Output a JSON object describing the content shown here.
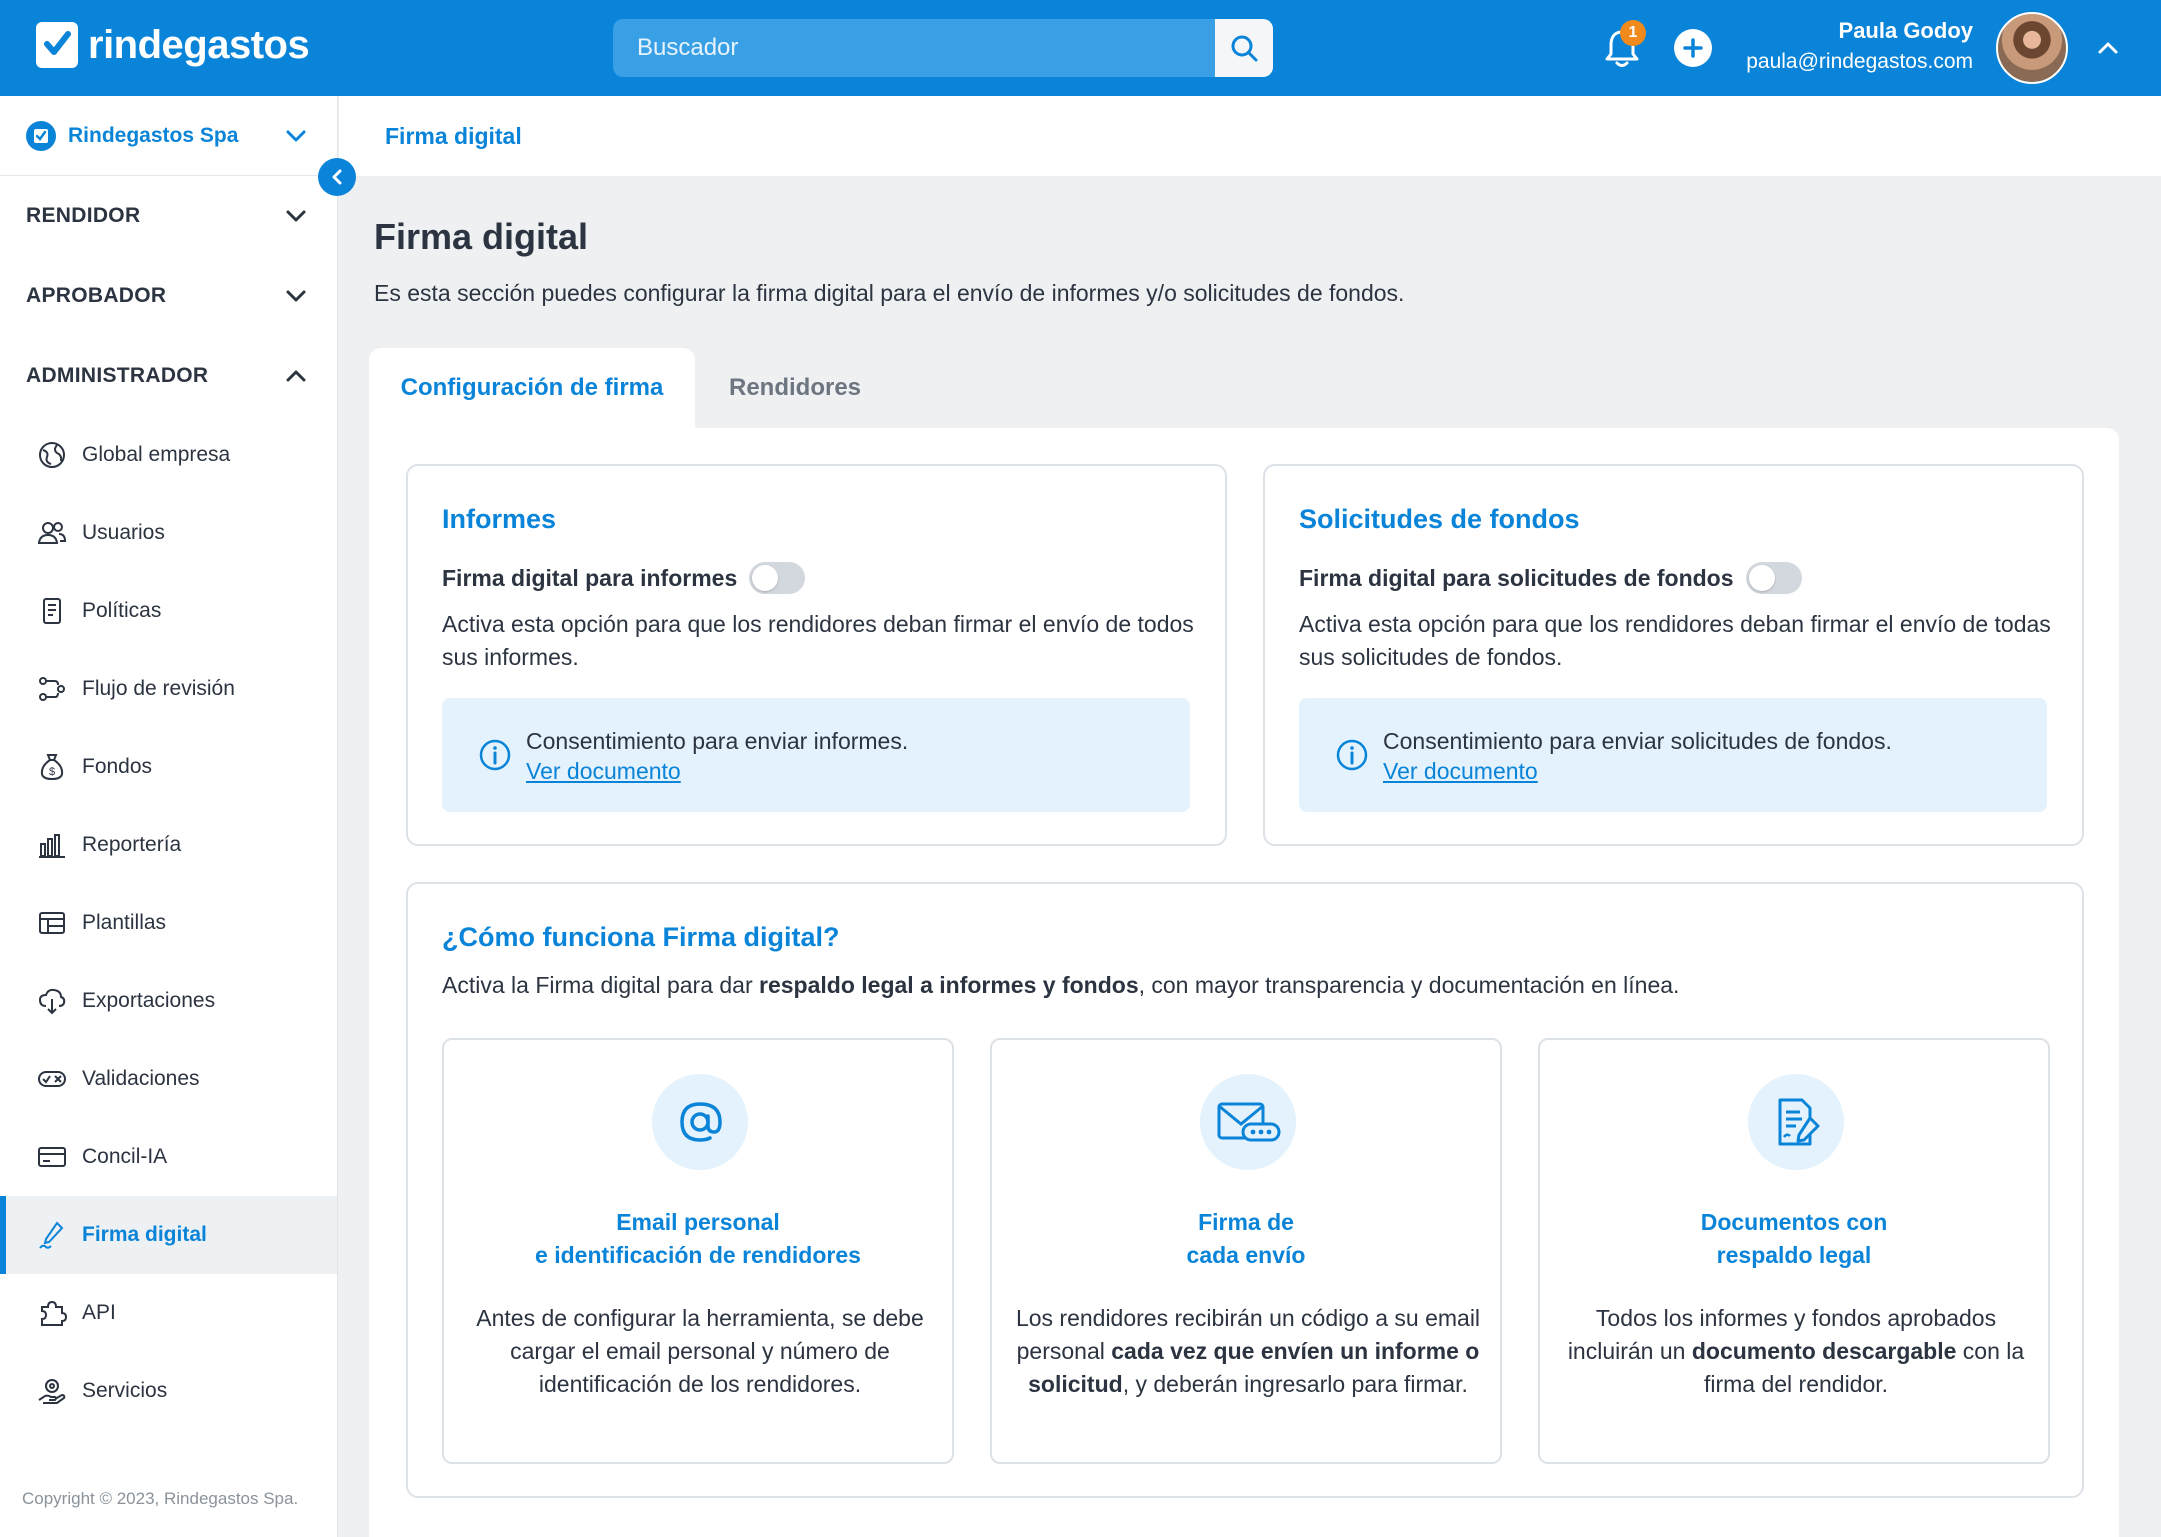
{
  "header": {
    "logo_text": "rindegastos",
    "search_placeholder": "Buscador",
    "notification_count": "1",
    "user_name": "Paula Godoy",
    "user_email": "paula@rindegastos.com"
  },
  "sidebar": {
    "company": "Rindegastos Spa",
    "sections": {
      "rendidor": "RENDIDOR",
      "aprobador": "APROBADOR",
      "administrador": "ADMINISTRADOR"
    },
    "items": [
      {
        "label": "Global empresa",
        "icon": "globe-icon"
      },
      {
        "label": "Usuarios",
        "icon": "users-icon"
      },
      {
        "label": "Políticas",
        "icon": "policy-icon"
      },
      {
        "label": "Flujo de revisión",
        "icon": "flow-icon"
      },
      {
        "label": "Fondos",
        "icon": "money-bag-icon"
      },
      {
        "label": "Reportería",
        "icon": "bar-chart-icon"
      },
      {
        "label": "Plantillas",
        "icon": "template-icon"
      },
      {
        "label": "Exportaciones",
        "icon": "cloud-download-icon"
      },
      {
        "label": "Validaciones",
        "icon": "validation-icon"
      },
      {
        "label": "Concil-IA",
        "icon": "card-icon"
      },
      {
        "label": "Firma digital",
        "icon": "pen-icon",
        "active": true
      },
      {
        "label": "API",
        "icon": "puzzle-icon"
      },
      {
        "label": "Servicios",
        "icon": "services-icon"
      }
    ],
    "copyright": "Copyright © 2023, Rindegastos Spa."
  },
  "breadcrumb": "Firma digital",
  "main": {
    "title": "Firma digital",
    "description": "Es esta sección puedes configurar la firma digital para el envío de informes y/o solicitudes de fondos.",
    "tabs": [
      "Configuración de firma",
      "Rendidores"
    ]
  },
  "informes": {
    "title": "Informes",
    "toggle_label": "Firma digital para informes",
    "toggle_on": false,
    "description": "Activa esta opción para que los rendidores deban firmar el envío de todos sus informes.",
    "info_text": "Consentimiento para enviar informes.",
    "info_link": "Ver documento"
  },
  "solicitudes": {
    "title": "Solicitudes de fondos",
    "toggle_label": "Firma digital para solicitudes de fondos",
    "toggle_on": false,
    "description": "Activa esta opción para que los rendidores deban firmar el envío de todas sus solicitudes de fondos.",
    "info_text": "Consentimiento para enviar solicitudes de fondos.",
    "info_link": "Ver documento"
  },
  "how": {
    "title": "¿Cómo funciona Firma digital?",
    "desc_pre": "Activa la Firma digital para dar ",
    "desc_bold": "respaldo legal a informes y fondos",
    "desc_post": ", con mayor transparencia y documentación en línea.",
    "features": [
      {
        "icon": "at-sign-icon",
        "title_1": "Email personal",
        "title_2": "e identificación de rendidores",
        "desc_pre": "Antes de configurar la herramienta, se debe cargar el email personal y número de identificación de los rendidores.",
        "desc_bold": "",
        "desc_post": ""
      },
      {
        "icon": "envelope-code-icon",
        "title_1": "Firma de",
        "title_2": "cada envío",
        "desc_pre": "Los rendidores recibirán un código a su email personal ",
        "desc_bold": "cada vez que envíen un informe o solicitud",
        "desc_post": ", y deberán ingresarlo para firmar."
      },
      {
        "icon": "signed-document-icon",
        "title_1": "Documentos con",
        "title_2": "respaldo legal",
        "desc_pre": "Todos los informes y fondos aprobados incluirán un ",
        "desc_bold": "documento descargable",
        "desc_post": " con la firma del rendidor."
      }
    ]
  },
  "colors": {
    "brand": "#0a84d8",
    "info_bg": "#e3f2fc",
    "badge": "#f08a1c"
  }
}
